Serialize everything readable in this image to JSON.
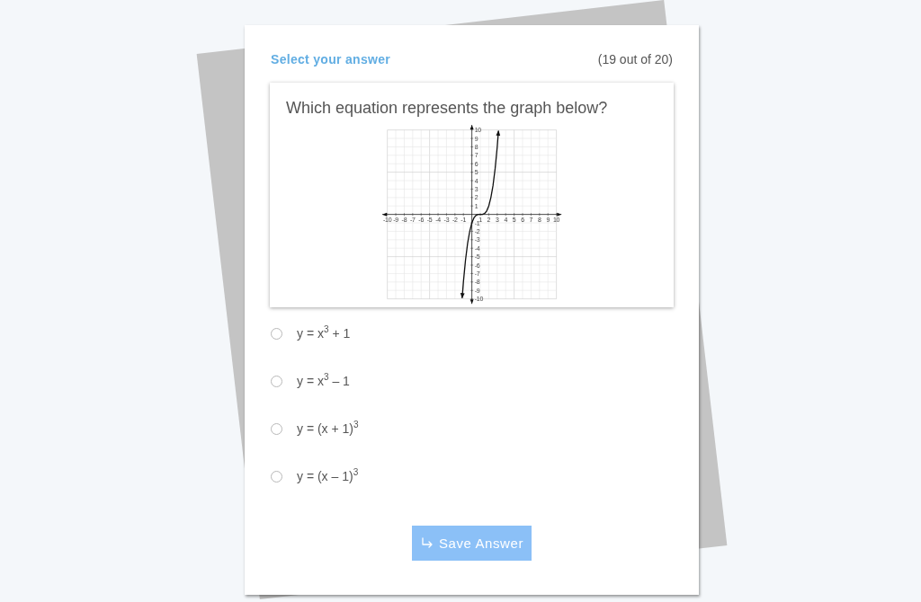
{
  "header": {
    "title": "Select your answer",
    "progress": "(19 out of 20)"
  },
  "question": {
    "text": "Which equation represents the graph below?",
    "chart_data": {
      "type": "line",
      "x": [
        -1.15,
        -1,
        -0.75,
        -0.5,
        -0.25,
        0,
        0.25,
        0.5,
        0.75,
        1,
        1.25,
        1.5,
        1.75,
        2,
        2.25,
        2.5,
        2.75,
        3,
        3.15
      ],
      "values": [
        -9.9,
        -8,
        -5.4,
        -3.4,
        -2,
        -1,
        -0.4,
        -0.1,
        0,
        0,
        0,
        0.1,
        0.4,
        1,
        2,
        3.4,
        5.4,
        8,
        9.9
      ],
      "color": "#111111",
      "xlim": [
        -10.6,
        10.6
      ],
      "ylim": [
        -10.6,
        10.6
      ],
      "xticks": [
        -10,
        -9,
        -8,
        -7,
        -6,
        -5,
        -4,
        -3,
        -2,
        -1,
        1,
        2,
        3,
        4,
        5,
        6,
        7,
        8,
        9,
        10
      ],
      "yticks": [
        -10,
        -9,
        -8,
        -7,
        -6,
        -5,
        -4,
        -3,
        -2,
        -1,
        1,
        2,
        3,
        4,
        5,
        6,
        7,
        8,
        9,
        10
      ],
      "grid": true
    }
  },
  "options": [
    {
      "label": "y = x$^{3}$ + 1",
      "selected": false
    },
    {
      "label": "y = x$^{3}$ – 1",
      "selected": false
    },
    {
      "label": "y = (x + 1)$^{3}$",
      "selected": false
    },
    {
      "label": "y = (x – 1)$^{3}$",
      "selected": false
    }
  ],
  "save_button": {
    "label": "Save Answer"
  }
}
